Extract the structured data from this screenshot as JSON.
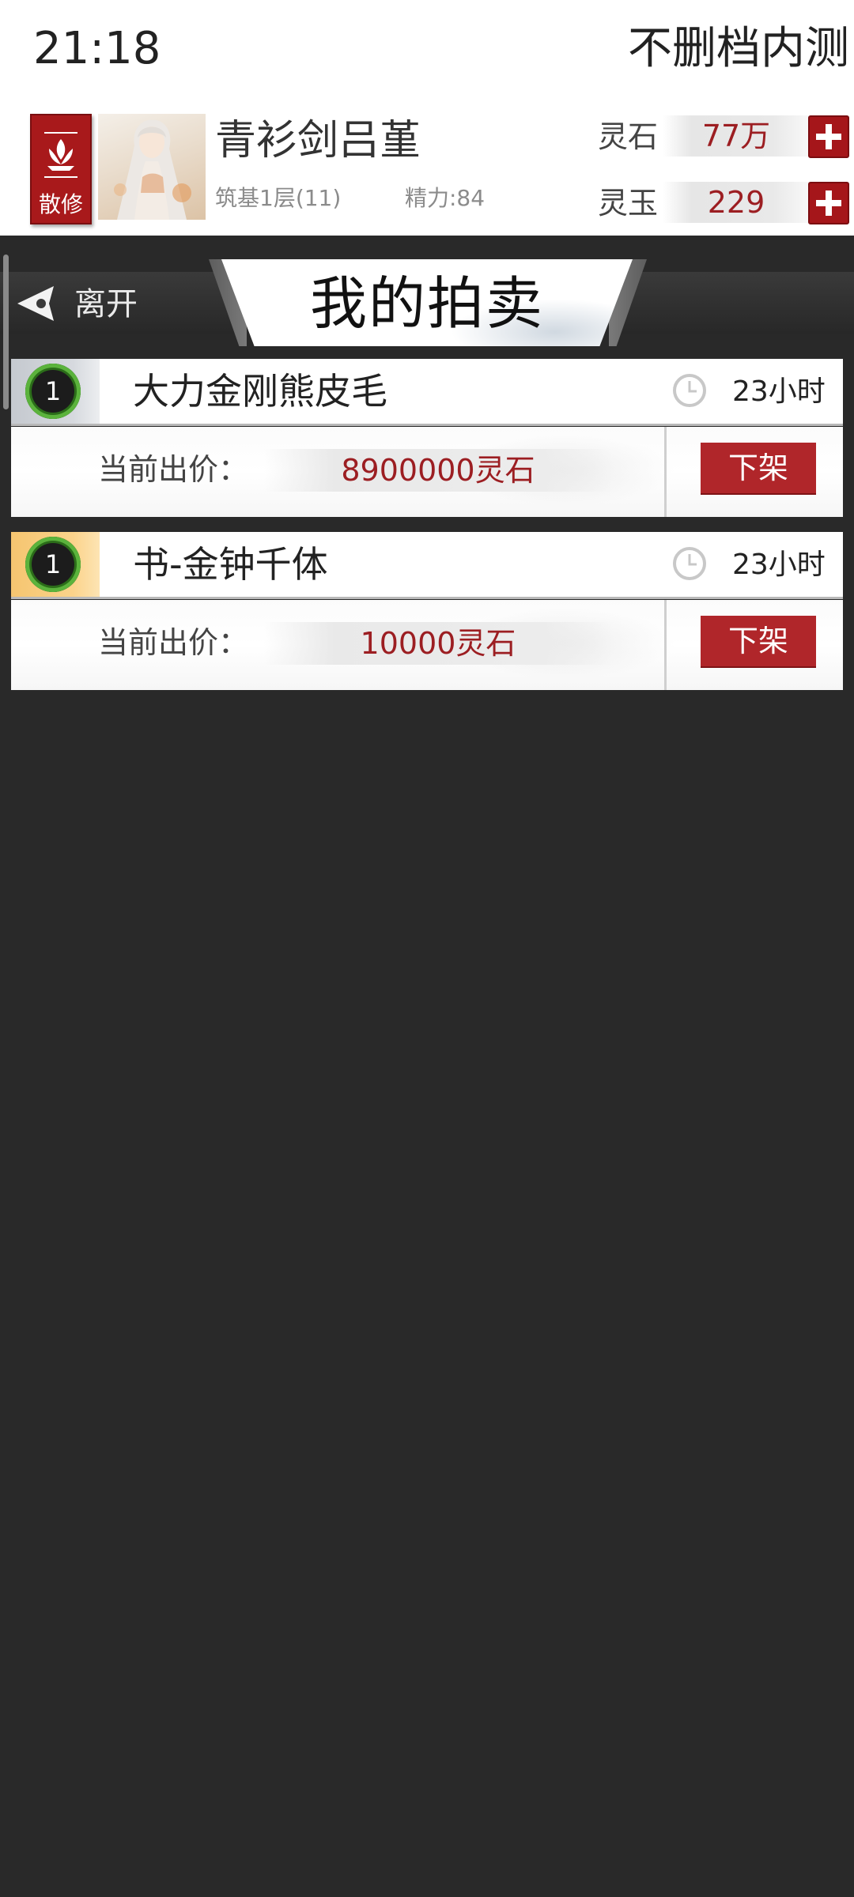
{
  "status_bar": {
    "time": "21:18",
    "server_name": "不删档内测"
  },
  "player": {
    "sect_badge": "散修",
    "name": "青衫剑吕堇",
    "realm": "筑基1层(11)",
    "energy": "精力:84",
    "currencies": [
      {
        "label": "灵石",
        "value": "77万"
      },
      {
        "label": "灵玉",
        "value": "229"
      }
    ]
  },
  "header": {
    "back_label": "离开",
    "title": "我的拍卖"
  },
  "auctions": [
    {
      "quantity": "1",
      "rarity_color": "#c9cdd3",
      "item_name": "大力金刚熊皮毛",
      "time_left": "23小时",
      "bid_label": "当前出价：",
      "bid_value": "8900000灵石",
      "action_label": "下架"
    },
    {
      "quantity": "1",
      "rarity_color": "#f8c979",
      "item_name": "书-金钟千体",
      "time_left": "23小时",
      "bid_label": "当前出价：",
      "bid_value": "10000灵石",
      "action_label": "下架"
    }
  ],
  "colors": {
    "accent_red": "#a8191b",
    "price_red": "#9c1e22",
    "background": "#292929"
  },
  "icons": {
    "sect_badge": "lotus-emblem-icon",
    "back": "back-arrow-icon",
    "plus": "plus-icon",
    "timer": "clock-icon"
  }
}
